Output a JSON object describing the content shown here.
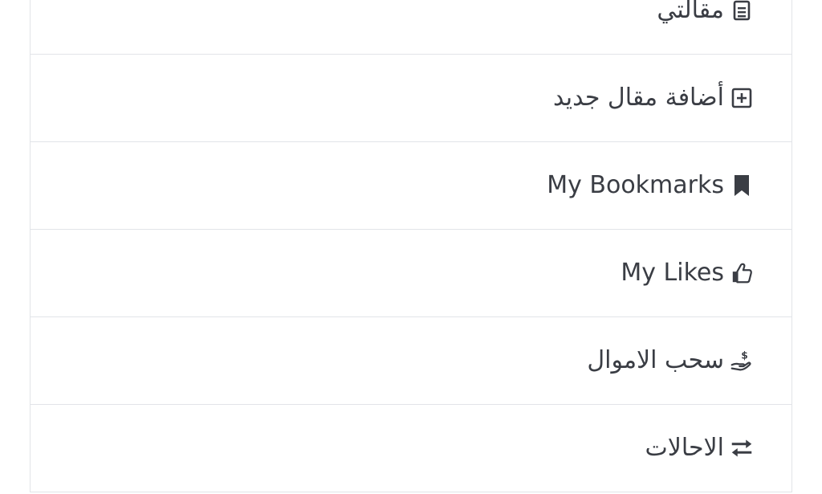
{
  "menu": {
    "items": [
      {
        "label": "مقالتي",
        "icon": "document-icon"
      },
      {
        "label": "أضافة مقال جديد",
        "icon": "plus-square-icon"
      },
      {
        "label": "My Bookmarks",
        "icon": "bookmark-icon"
      },
      {
        "label": "My Likes",
        "icon": "thumbs-up-icon"
      },
      {
        "label": "سحب الاموال",
        "icon": "hand-holding-dollar-icon"
      },
      {
        "label": "الاحالات",
        "icon": "exchange-arrows-icon"
      }
    ]
  },
  "colors": {
    "text": "#3a3d44",
    "icon": "#3a3d44",
    "divider": "#e2e4e8",
    "background": "#ffffff"
  }
}
